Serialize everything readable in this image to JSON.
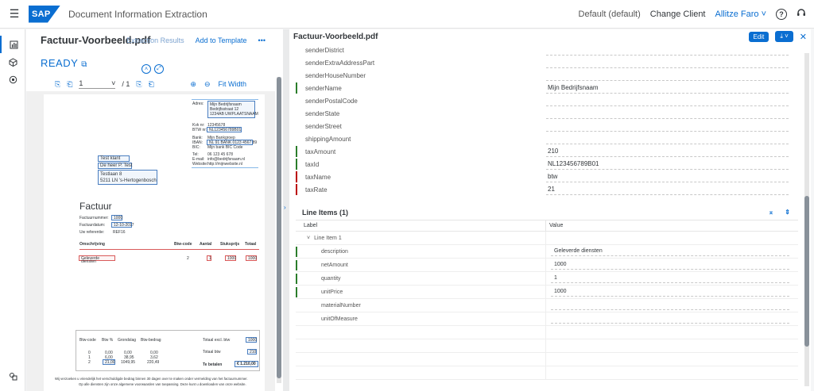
{
  "shell": {
    "app_title": "Document Information Extraction",
    "logo": "SAP",
    "default_label": "Default (default)",
    "change_client": "Change Client",
    "user": "Allitze Faro ˅",
    "help_icon": "?",
    "headset_icon": "headset-icon"
  },
  "left": {
    "doc_title": "Factuur-Voorbeeld.pdf",
    "extraction_results": "Extraction Results",
    "add_to_template": "Add to Template",
    "more": "•••",
    "status": "READY",
    "toolbar": {
      "page": "1",
      "page_total": "/ 1",
      "fit_width": "Fit Width"
    }
  },
  "doc": {
    "addr_labels": [
      "Adres:",
      "Kvk nr:",
      "BTW nr:",
      "Bank:",
      "IBAN:",
      "BIC:",
      "Tel:",
      "E-mail:",
      "Website:"
    ],
    "sender_name": "Mijn Bedrijfsnaam",
    "sender_street": "Bedrijfsstraat 12",
    "sender_city": "1234AB UWPLAATSNAAM",
    "kvk": "12345678",
    "btw": "NL123456789B01",
    "bank": "Mijn Bankgroep",
    "iban": "NL 91 BANK 0123 4567 89",
    "bic": "Mijn bank BIC Code",
    "tel": "06 123 45 678",
    "email": "info@bedrijfsnaam.nl",
    "website": "http://mijnwebsite.nl",
    "recipient": [
      "Test klant",
      "De heer P. Test",
      "Testlaan 8",
      "5211 LN 's-Hertogenbosch"
    ],
    "invoice_title": "Factuur",
    "fields": [
      {
        "label": "Factuurnummer:",
        "value": "1000"
      },
      {
        "label": "Factuurdatum:",
        "value": "12-10-2017"
      },
      {
        "label": "Uw referentie:",
        "value": "REF16"
      }
    ],
    "cols": [
      "Omschrijving",
      "Btw-code",
      "Aantal",
      "Stuksprijs",
      "Totaal"
    ],
    "line": {
      "desc": "Geleverde diensten",
      "code": "2",
      "qty": "1",
      "price": "1000",
      "total": "1000"
    },
    "btw_cols": [
      "Btw-code",
      "Btw %",
      "Grondslag",
      "Btw-bedrag"
    ],
    "btw_rows": [
      [
        "0",
        "0,00",
        "0,00",
        "0,00"
      ],
      [
        "1",
        "6,00",
        "38,95",
        "3,62"
      ],
      [
        "2",
        "21,00",
        "1049,95",
        "220,49"
      ]
    ],
    "totals": [
      {
        "label": "Totaal excl. btw",
        "value": "1000"
      },
      {
        "label": "Totaal btw",
        "value": "210"
      },
      {
        "label": "Te betalen",
        "value": "€ 1.210,00"
      }
    ],
    "footer1": "Wij verzoeken u vriendelijk het verschuldigde bedrag binnen 30 dagen over te maken onder vermelding van het factuurnummer.",
    "footer2": "Op alle diensten zijn onze algemene voorwaarden van toepassing. Deze kunt u downloaden van onze website."
  },
  "right": {
    "title": "Factuur-Voorbeeld.pdf",
    "edit": "Edit",
    "download": "⤓ ˅",
    "close": "✕",
    "rows": [
      {
        "label": "senderDistrict",
        "value": "",
        "status": ""
      },
      {
        "label": "senderExtraAddressPart",
        "value": "",
        "status": ""
      },
      {
        "label": "senderHouseNumber",
        "value": "",
        "status": ""
      },
      {
        "label": "senderName",
        "value": "Mijn Bedrijfsnaam",
        "status": "ok"
      },
      {
        "label": "senderPostalCode",
        "value": "",
        "status": ""
      },
      {
        "label": "senderState",
        "value": "",
        "status": ""
      },
      {
        "label": "senderStreet",
        "value": "",
        "status": ""
      },
      {
        "label": "shippingAmount",
        "value": "",
        "status": ""
      },
      {
        "label": "taxAmount",
        "value": "210",
        "status": "ok"
      },
      {
        "label": "taxId",
        "value": "NL123456789B01",
        "status": "ok"
      },
      {
        "label": "taxName",
        "value": "btw",
        "status": "err"
      },
      {
        "label": "taxRate",
        "value": "21",
        "status": "err"
      }
    ],
    "line_items": {
      "title": "Line Items (1)",
      "col_label": "Label",
      "col_value": "Value",
      "group": "Line Item 1",
      "rows": [
        {
          "label": "description",
          "value": "Geleverde diensten",
          "status": "ok"
        },
        {
          "label": "netAmount",
          "value": "1000",
          "status": "ok"
        },
        {
          "label": "quantity",
          "value": "1",
          "status": "ok"
        },
        {
          "label": "unitPrice",
          "value": "1000",
          "status": "ok"
        },
        {
          "label": "materialNumber",
          "value": "",
          "status": ""
        },
        {
          "label": "unitOfMeasure",
          "value": "",
          "status": ""
        }
      ]
    }
  }
}
